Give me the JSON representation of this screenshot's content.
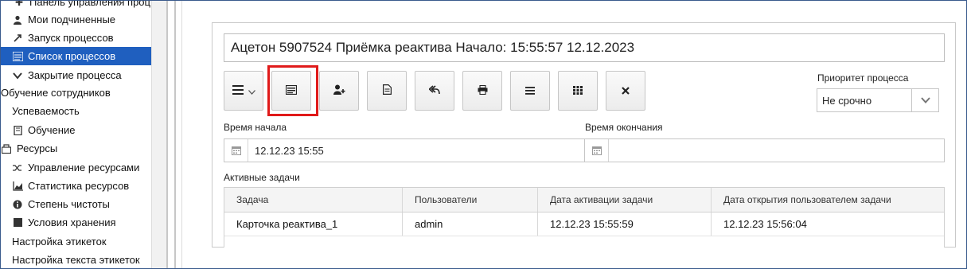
{
  "sidebar": {
    "items": [
      {
        "label": "Панель управления проц",
        "icon": "wrench-icon",
        "indent": 1
      },
      {
        "label": "Мои подчиненные",
        "icon": "user-icon",
        "indent": 1
      },
      {
        "label": "Запуск процессов",
        "icon": "play-icon",
        "indent": 1
      },
      {
        "label": "Список процессов",
        "icon": "list-icon",
        "indent": 1,
        "active": true
      },
      {
        "label": "Закрытие процесса",
        "icon": "chevron-down-icon",
        "indent": 1
      },
      {
        "label": "Обучение сотрудников",
        "icon": "",
        "indent": 0
      },
      {
        "label": "Успеваемость",
        "icon": "",
        "indent": 1
      },
      {
        "label": "Обучение",
        "icon": "book-icon",
        "indent": 1
      },
      {
        "label": "Ресурсы",
        "icon": "resources-icon",
        "indent": 0
      },
      {
        "label": "Управление ресурсами",
        "icon": "shuffle-icon",
        "indent": 1
      },
      {
        "label": "Статистика ресурсов",
        "icon": "chart-icon",
        "indent": 1
      },
      {
        "label": "Степень чистоты",
        "icon": "info-icon",
        "indent": 1
      },
      {
        "label": "Условия хранения",
        "icon": "square-icon",
        "indent": 1
      },
      {
        "label": "Настройка этикеток",
        "icon": "",
        "indent": 1
      },
      {
        "label": "Настройка текста этикеток",
        "icon": "",
        "indent": 1
      }
    ]
  },
  "panel": {
    "title": "Ацетон 5907524 Приёмка реактива Начало: 15:55:57 12.12.2023",
    "toolbar": [
      {
        "name": "menu-dropdown-button",
        "icon": "hamburger-icon"
      },
      {
        "name": "process-card-button",
        "icon": "card-icon"
      },
      {
        "name": "add-user-button",
        "icon": "add-user-icon"
      },
      {
        "name": "document-button",
        "icon": "document-icon"
      },
      {
        "name": "reply-all-button",
        "icon": "reply-all-icon"
      },
      {
        "name": "print-button",
        "icon": "print-icon"
      },
      {
        "name": "list-button",
        "icon": "list-lines-icon"
      },
      {
        "name": "grid-button",
        "icon": "grid-icon"
      },
      {
        "name": "close-button",
        "icon": "close-icon"
      }
    ],
    "priority": {
      "label": "Приоритет процесса",
      "value": "Не срочно"
    },
    "start_time": {
      "label": "Время начала",
      "value": "12.12.23 15:55"
    },
    "end_time": {
      "label": "Время окончания",
      "value": ""
    },
    "active_tasks": {
      "label": "Активные задачи",
      "columns": [
        "Задача",
        "Пользователи",
        "Дата активации задачи",
        "Дата открытия пользователем задачи"
      ],
      "rows": [
        [
          "Карточка реактива_1",
          "admin",
          "12.12.23 15:55:59",
          "12.12.23 15:56:04"
        ]
      ]
    }
  },
  "colors": {
    "accent": "#1f5fbf",
    "highlight": "#e01a1a"
  }
}
